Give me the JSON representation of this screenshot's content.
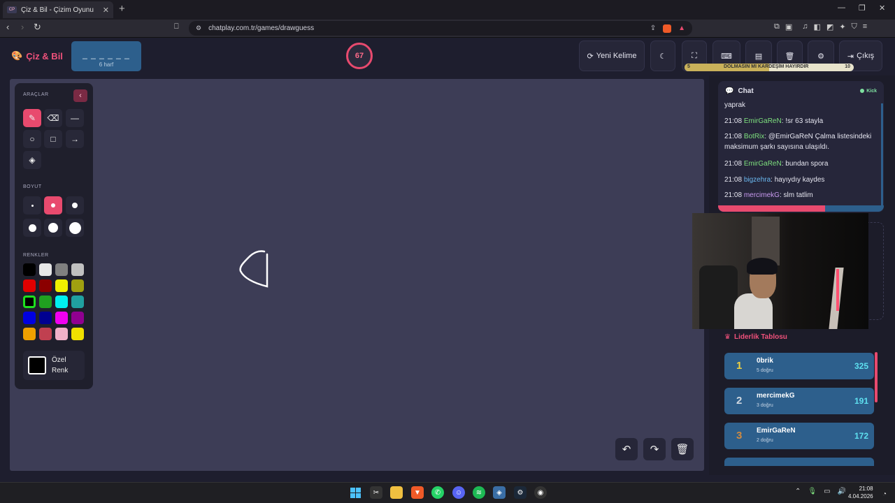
{
  "browser": {
    "tab_title": "Çiz & Bil - Çizim Oyunu",
    "tab_icon_text": "CP",
    "url": "chatplay.com.tr/games/drawguess"
  },
  "header": {
    "logo": "Çiz & Bil",
    "word_mask": "_ _ _ _ _ _",
    "word_hint": "6 harf",
    "timer": "67",
    "new_word": "Yeni Kelime",
    "exit": "Çıkış"
  },
  "progress": {
    "left_num": "5",
    "text": "DOLMASIN MI KARDEŞİM HAYIRDIR",
    "right_num": "10",
    "fraction": 0.5
  },
  "tools": {
    "tools_title": "ARAÇLAR",
    "size_title": "BOYUT",
    "colors_title": "RENKLER",
    "custom_line1": "Özel",
    "custom_line2": "Renk",
    "colors": [
      "#000000",
      "#e8e8e8",
      "#808080",
      "#c0c0c0",
      "#e00000",
      "#8b0000",
      "#f0f000",
      "#a0a010",
      "#00a000",
      "#20a020",
      "#00f0f0",
      "#20a0a0",
      "#0000e0",
      "#000090",
      "#f000f0",
      "#900090",
      "#f0a000",
      "#c04050",
      "#f0b0c8",
      "#f0e000"
    ]
  },
  "chat": {
    "title": "Chat",
    "status": "Kick",
    "partial": "yaprak",
    "messages": [
      {
        "time": "21:08",
        "user": "EmirGaReN",
        "color": "#7ee07e",
        "text": ": !sr 63 stayla"
      },
      {
        "time": "21:08",
        "user": "BotRix",
        "color": "#7ee07e",
        "text": ": @EmirGaReN Çalma listesindeki maksimum şarkı sayısına ulaşıldı."
      },
      {
        "time": "21:08",
        "user": "EmirGaReN",
        "color": "#7ee07e",
        "text": ": bundan spora"
      },
      {
        "time": "21:08",
        "user": "bigzehra",
        "color": "#6ab8f0",
        "text": ": hayıydıy kaydes"
      },
      {
        "time": "21:08",
        "user": "mercimekG",
        "color": "#c89af0",
        "text": ": slm tatlim"
      }
    ]
  },
  "leaderboard": {
    "title": "Liderlik Tablosu",
    "rows": [
      {
        "rank": "1",
        "name": "0brik",
        "correct": "5 doğru",
        "score": "325",
        "rank_color": "#f0d040"
      },
      {
        "rank": "2",
        "name": "mercimekG",
        "correct": "3 doğru",
        "score": "191",
        "rank_color": "#d0d8e0"
      },
      {
        "rank": "3",
        "name": "EmirGaReN",
        "correct": "2 doğru",
        "score": "172",
        "rank_color": "#d08a40"
      }
    ]
  },
  "taskbar": {
    "time": "21:08",
    "date": "4.04.2026"
  }
}
